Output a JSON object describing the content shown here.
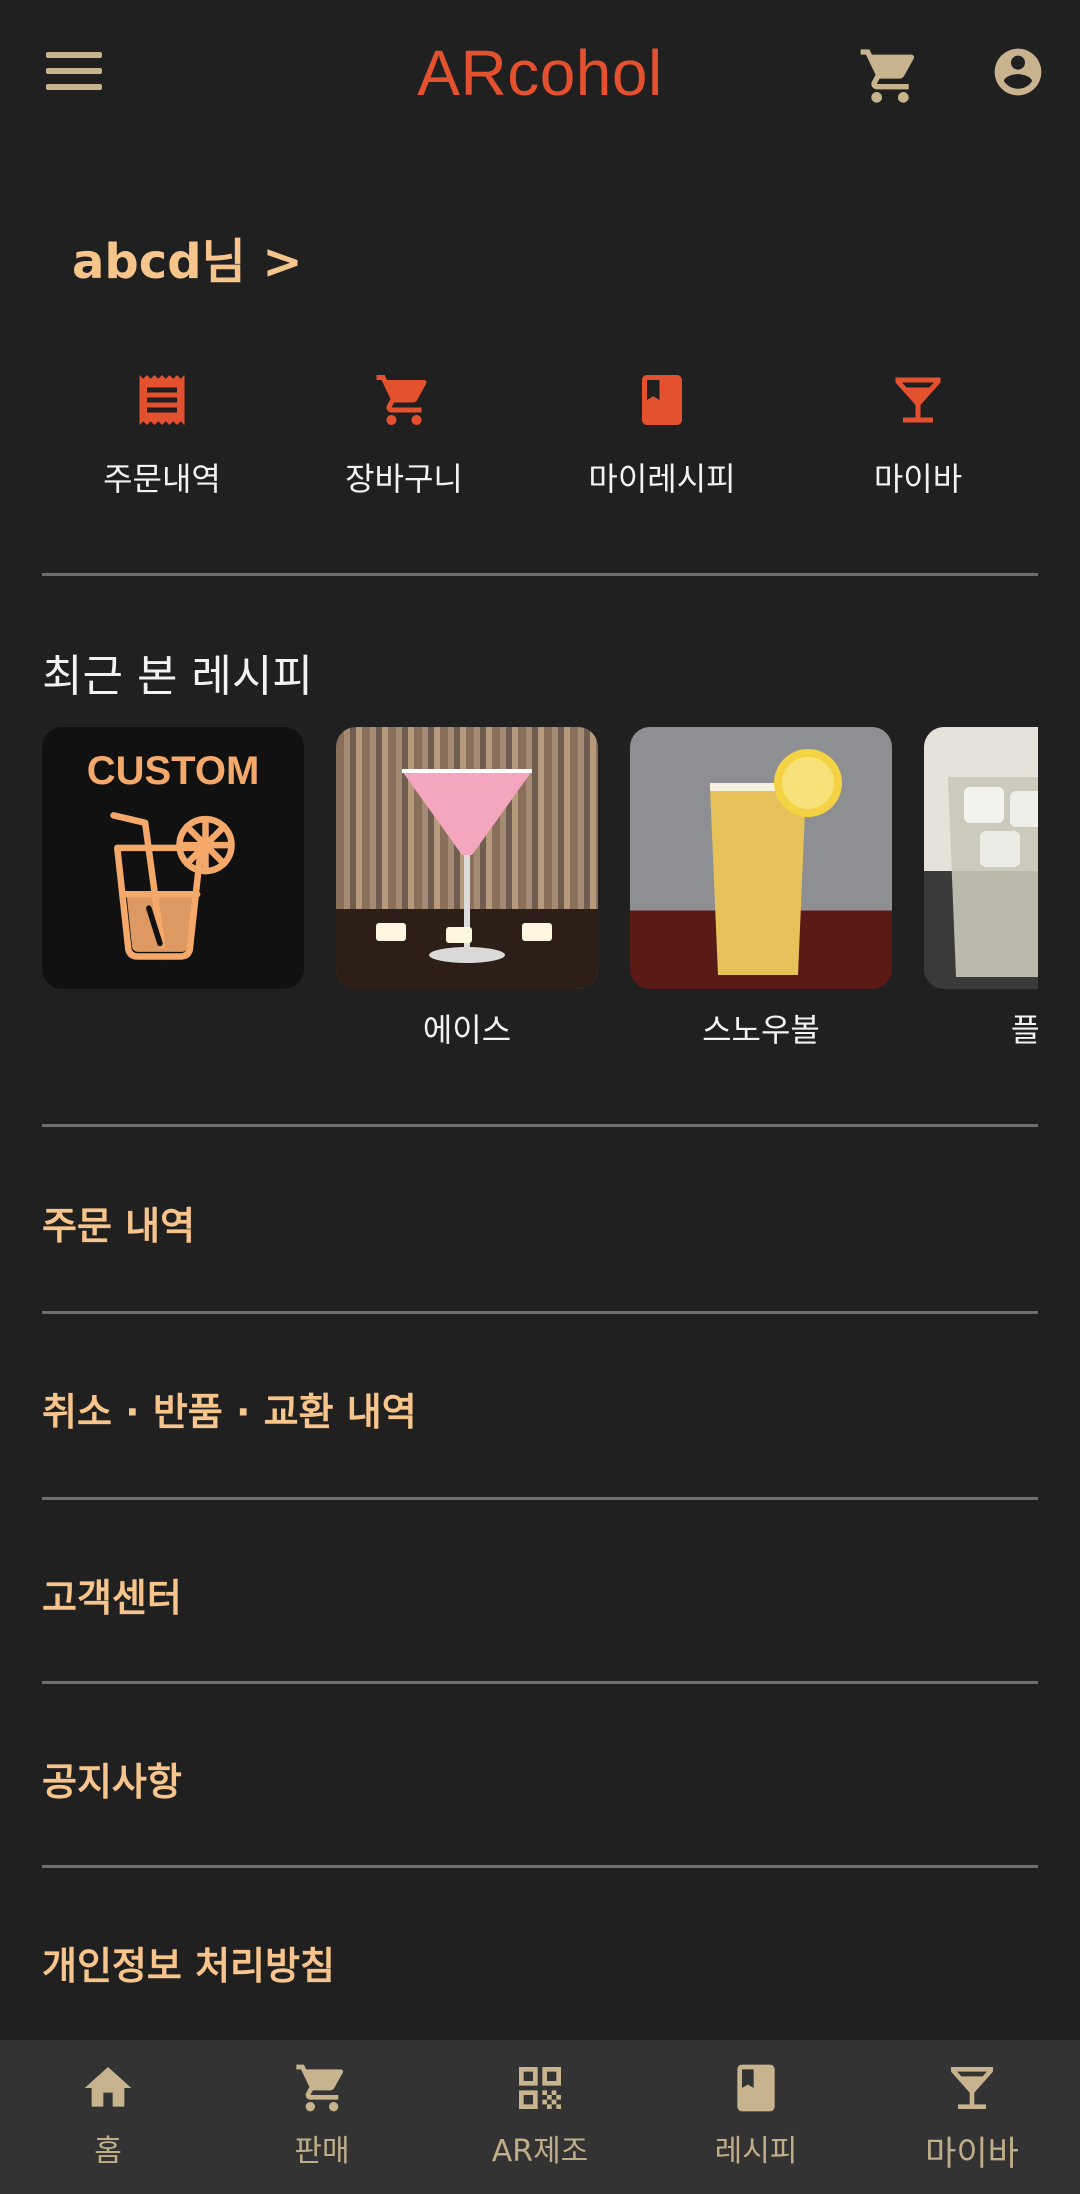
{
  "colors": {
    "accent": "#e4512f",
    "gold": "#f7c58b",
    "icon": "#c7b48e",
    "background": "#202020",
    "nav_background": "#333333"
  },
  "header": {
    "title": "ARcohol",
    "menu_icon": "hamburger-menu-icon",
    "cart_icon": "cart-icon",
    "account_icon": "account-circle-icon"
  },
  "user": {
    "greeting": "abcd님 >"
  },
  "shortcuts": [
    {
      "label": "주문내역",
      "icon": "receipt-icon"
    },
    {
      "label": "장바구니",
      "icon": "cart-icon"
    },
    {
      "label": "마이레시피",
      "icon": "book-icon"
    },
    {
      "label": "마이바",
      "icon": "cocktail-glass-icon"
    }
  ],
  "recent": {
    "title": "최근 본 레시피",
    "items": [
      {
        "label": "",
        "image": "custom-recipe-image",
        "badge": "CUSTOM"
      },
      {
        "label": "에이스",
        "image": "pink-martini-photo"
      },
      {
        "label": "스노우볼",
        "image": "yellow-lemon-drink-photo"
      },
      {
        "label": "플라잉",
        "image": "clear-ice-drink-photo"
      }
    ]
  },
  "menu": [
    {
      "label": "주문 내역"
    },
    {
      "label": "취소 · 반품 · 교환 내역"
    },
    {
      "label": "고객센터"
    },
    {
      "label": "공지사항"
    },
    {
      "label": "개인정보 처리방침"
    }
  ],
  "bottom_nav": [
    {
      "label": "홈",
      "icon": "home-icon"
    },
    {
      "label": "판매",
      "icon": "cart-icon"
    },
    {
      "label": "AR제조",
      "icon": "qr-code-icon"
    },
    {
      "label": "레시피",
      "icon": "book-icon"
    },
    {
      "label": "마이바",
      "icon": "cocktail-glass-icon"
    }
  ]
}
